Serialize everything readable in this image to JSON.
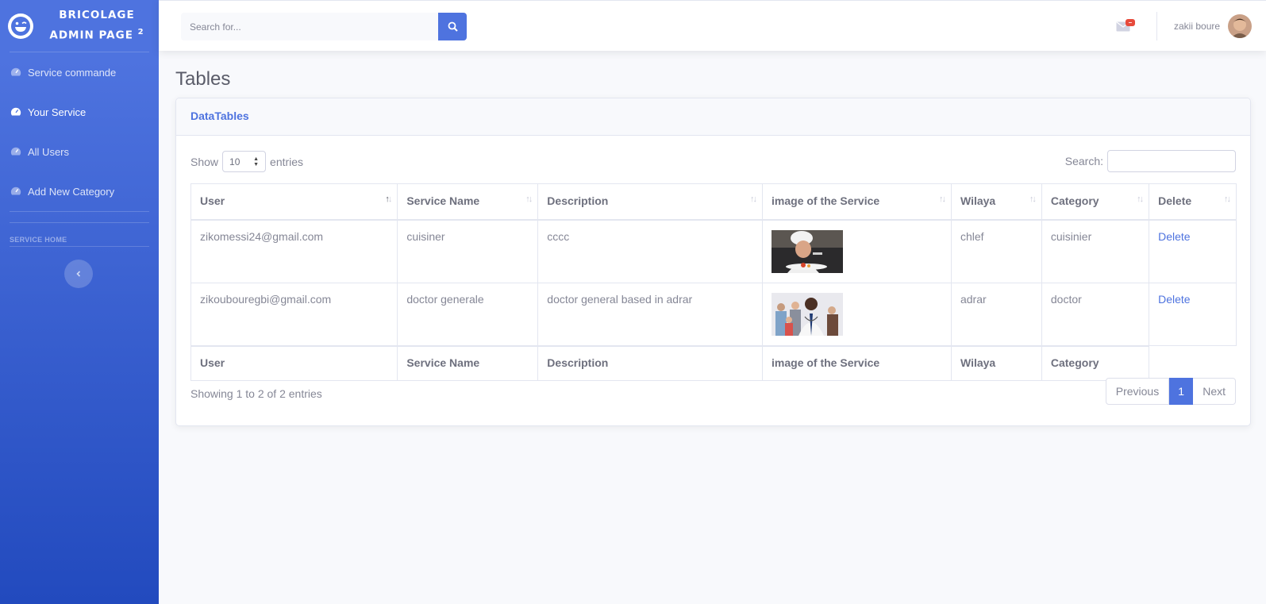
{
  "sidebar": {
    "brand_line1": "BRICOLAGE",
    "brand_line2": "ADMIN PAGE",
    "brand_sup": "2",
    "items": [
      {
        "label": "Service commande",
        "icon": "tachometer-icon"
      },
      {
        "label": "Your Service",
        "icon": "tachometer-icon"
      },
      {
        "label": "All Users",
        "icon": "tachometer-icon"
      },
      {
        "label": "Add New Category",
        "icon": "tachometer-icon"
      }
    ],
    "heading": "SERVICE HOME"
  },
  "topbar": {
    "search_placeholder": "Search for...",
    "user_name": "zakii boure"
  },
  "page": {
    "title": "Tables",
    "card_title": "DataTables"
  },
  "table_controls": {
    "show_label": "Show",
    "length_value": "10",
    "entries_label": "entries",
    "search_label": "Search:"
  },
  "table": {
    "headers": [
      "User",
      "Service Name",
      "Description",
      "image of the Service",
      "Wilaya",
      "Category",
      "Delete"
    ],
    "rows": [
      {
        "user": "zikomessi24@gmail.com",
        "service": "cuisiner",
        "description": "cccc",
        "image": "chef-photo",
        "wilaya": "chlef",
        "category": "cuisinier",
        "action": "Delete"
      },
      {
        "user": "zikoubouregbi@gmail.com",
        "service": "doctor generale",
        "description": "doctor general based in adrar",
        "image": "doctor-photo",
        "wilaya": "adrar",
        "category": "doctor",
        "action": "Delete"
      }
    ],
    "footer": [
      "User",
      "Service Name",
      "Description",
      "image of the Service",
      "Wilaya",
      "Category"
    ]
  },
  "pagination": {
    "info": "Showing 1 to 2 of 2 entries",
    "previous": "Previous",
    "current": "1",
    "next": "Next"
  },
  "colors": {
    "primary": "#4e73df",
    "danger": "#e74a3b"
  }
}
